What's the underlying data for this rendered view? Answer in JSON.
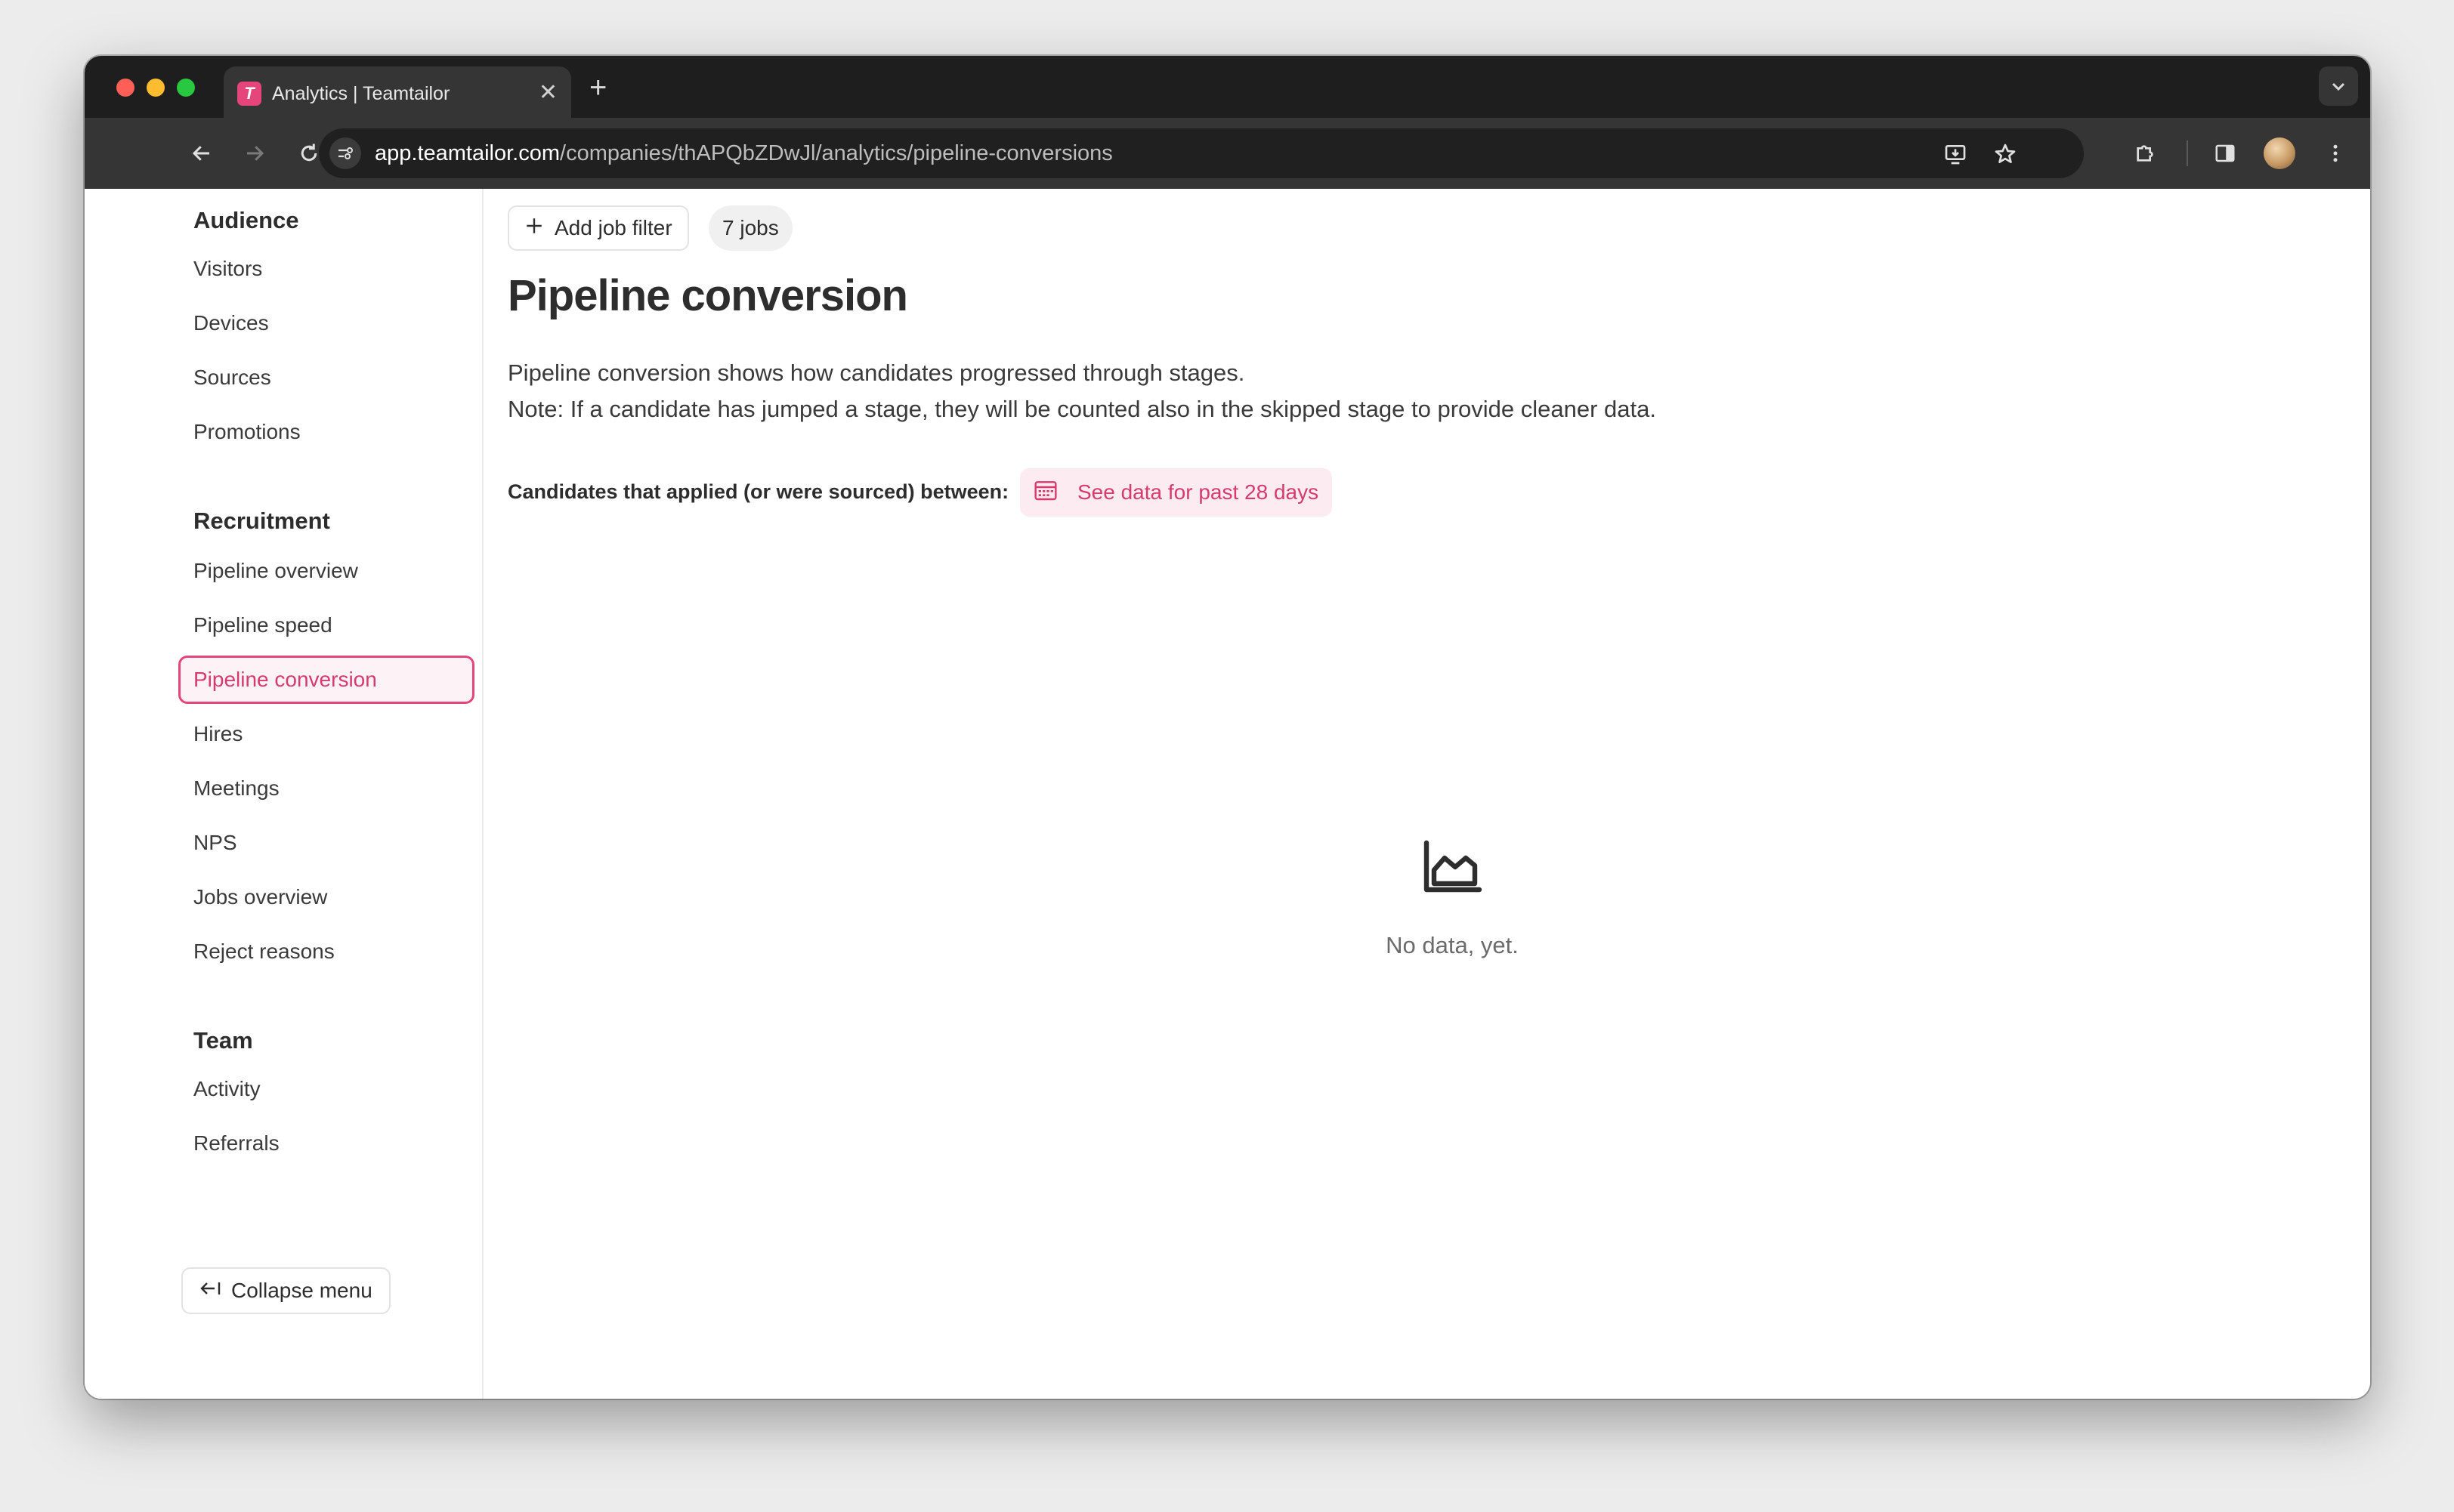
{
  "browser": {
    "tab_title": "Analytics | Teamtailor",
    "favicon_letter": "T",
    "url_host": "app.teamtailor.com",
    "url_path": "/companies/thAPQbZDwJl/analytics/pipeline-conversions"
  },
  "sidebar": {
    "sections": [
      {
        "heading": "Audience",
        "items": [
          "Visitors",
          "Devices",
          "Sources",
          "Promotions"
        ]
      },
      {
        "heading": "Recruitment",
        "items": [
          "Pipeline overview",
          "Pipeline speed",
          "Pipeline conversion",
          "Hires",
          "Meetings",
          "NPS",
          "Jobs overview",
          "Reject reasons"
        ]
      },
      {
        "heading": "Team",
        "items": [
          "Activity",
          "Referrals"
        ]
      }
    ],
    "active_item": "Pipeline conversion",
    "collapse_label": "Collapse menu"
  },
  "main": {
    "add_filter_label": "Add job filter",
    "jobs_count_label": "7 jobs",
    "title": "Pipeline conversion",
    "description_1": "Pipeline conversion shows how candidates progressed through stages.",
    "description_2": "Note: If a candidate has jumped a stage, they will be counted also in the skipped stage to provide cleaner data.",
    "range_label": "Candidates that applied (or were sourced) between:",
    "date_button_label": "See data for past 28 days",
    "empty_text": "No data, yet."
  },
  "colors": {
    "accent": "#e5457b",
    "accent_text": "#d63a6e",
    "accent_bg": "#fcebf1"
  }
}
